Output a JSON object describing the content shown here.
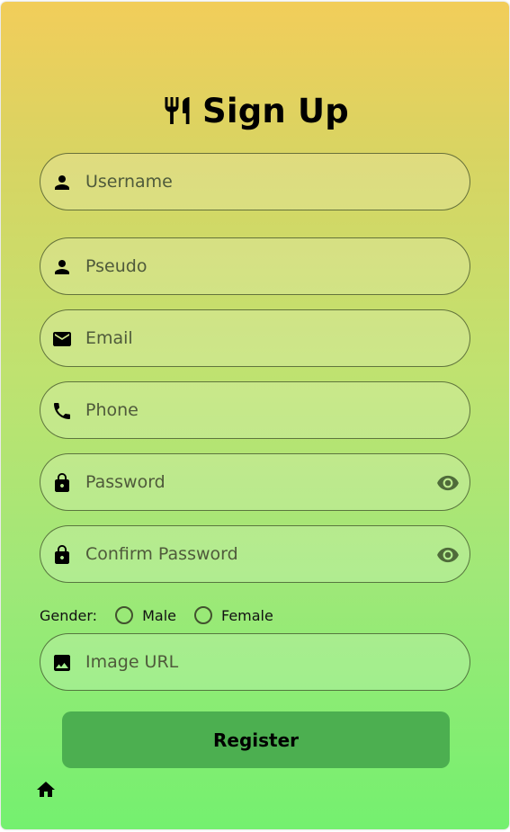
{
  "header": {
    "title": "Sign Up",
    "icon": "restaurant-icon"
  },
  "form": {
    "fields": [
      {
        "name": "username",
        "placeholder": "Username",
        "value": "",
        "icon": "person-icon"
      },
      {
        "name": "pseudo",
        "placeholder": "Pseudo",
        "value": "",
        "icon": "person-icon"
      },
      {
        "name": "email",
        "placeholder": "Email",
        "value": "",
        "icon": "mail-icon"
      },
      {
        "name": "phone",
        "placeholder": "Phone",
        "value": "",
        "icon": "phone-icon"
      },
      {
        "name": "password",
        "placeholder": "Password",
        "value": "",
        "icon": "lock-icon",
        "toggle_icon": "eye-icon"
      },
      {
        "name": "confirm_password",
        "placeholder": "Confirm Password",
        "value": "",
        "icon": "lock-icon",
        "toggle_icon": "eye-icon"
      },
      {
        "name": "image_url",
        "placeholder": "Image URL",
        "value": "",
        "icon": "image-icon"
      }
    ],
    "gender": {
      "label": "Gender:",
      "options": [
        "Male",
        "Female"
      ],
      "selected": null
    },
    "submit_label": "Register"
  },
  "footer": {
    "home_icon": "home-icon"
  },
  "colors": {
    "gradient_top": "#f2cd5a",
    "gradient_bottom": "#74f06f",
    "button": "#4caf50",
    "eye_icon": "#4f6b3a"
  }
}
